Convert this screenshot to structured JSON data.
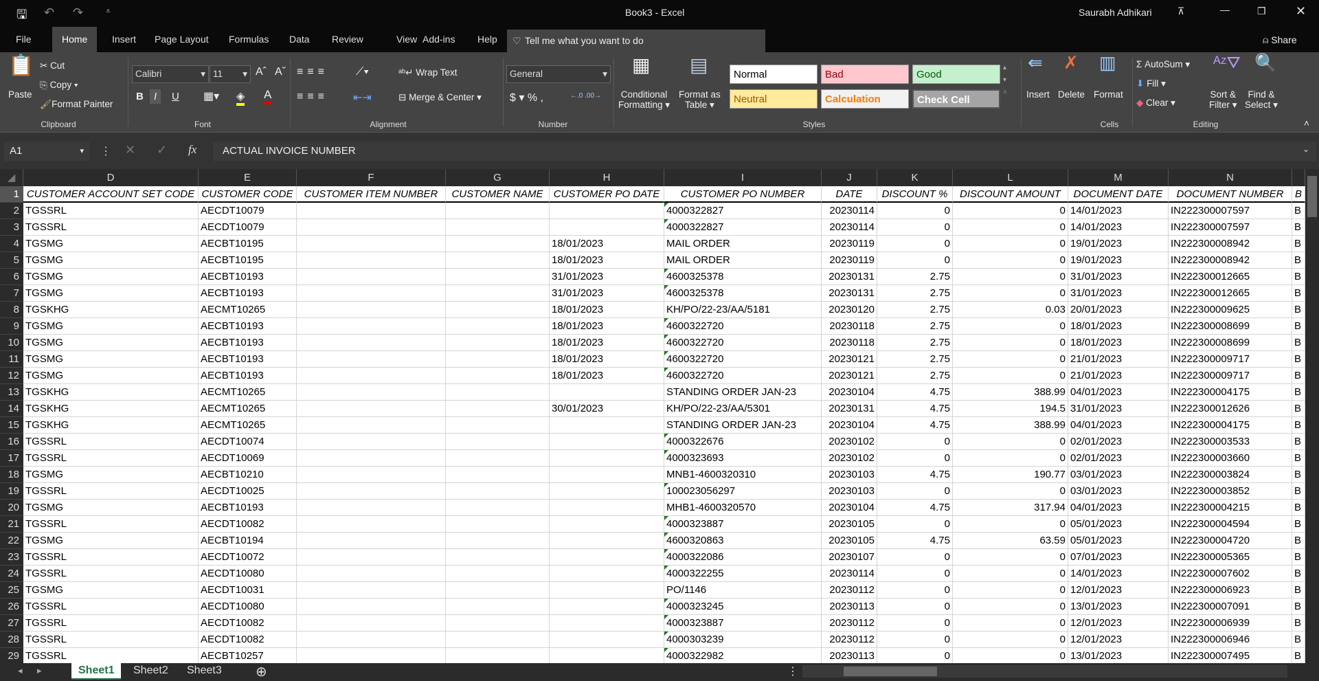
{
  "window": {
    "title": "Book3  -  Excel",
    "user": "Saurabh Adhikari",
    "share": "Share"
  },
  "menu_tabs": [
    "File",
    "Home",
    "Insert",
    "Page Layout",
    "Formulas",
    "Data",
    "Review",
    "View",
    "Add-ins",
    "Help"
  ],
  "active_tab": "Home",
  "tell_me": "Tell me what you want to do",
  "ribbon": {
    "clipboard": {
      "paste": "Paste",
      "cut": "Cut",
      "copy": "Copy",
      "format_painter": "Format Painter",
      "label": "Clipboard"
    },
    "font": {
      "name": "Calibri",
      "size": "11",
      "label": "Font",
      "bold": "B",
      "italic": "I",
      "underline": "U"
    },
    "alignment": {
      "wrap": "Wrap Text",
      "merge": "Merge & Center",
      "label": "Alignment"
    },
    "number": {
      "format": "General",
      "label": "Number"
    },
    "styles": {
      "conditional": "Conditional",
      "conditional2": "Formatting",
      "format_table": "Format as",
      "format_table2": "Table",
      "label": "Styles",
      "cells": [
        {
          "name": "Normal",
          "bg": "#ffffff",
          "fg": "#000000"
        },
        {
          "name": "Bad",
          "bg": "#ffc7ce",
          "fg": "#9c0006"
        },
        {
          "name": "Good",
          "bg": "#c6efce",
          "fg": "#006100"
        },
        {
          "name": "Neutral",
          "bg": "#ffeb9c",
          "fg": "#9c5700"
        },
        {
          "name": "Calculation",
          "bg": "#f2f2f2",
          "fg": "#fa7d00"
        },
        {
          "name": "Check Cell",
          "bg": "#a5a5a5",
          "fg": "#ffffff"
        }
      ]
    },
    "cells": {
      "insert": "Insert",
      "delete": "Delete",
      "format": "Format",
      "label": "Cells"
    },
    "editing": {
      "autosum": "AutoSum",
      "fill": "Fill",
      "clear": "Clear",
      "sort": "Sort &",
      "sort2": "Filter",
      "find": "Find &",
      "find2": "Select",
      "label": "Editing"
    }
  },
  "formula_bar": {
    "name_box": "A1",
    "formula": "ACTUAL INVOICE NUMBER"
  },
  "columns": [
    "D",
    "E",
    "F",
    "G",
    "H",
    "I",
    "J",
    "K",
    "L",
    "M",
    "N",
    ""
  ],
  "headers": [
    "CUSTOMER ACCOUNT SET CODE",
    "CUSTOMER CODE",
    "CUSTOMER ITEM NUMBER",
    "CUSTOMER NAME",
    "CUSTOMER PO DATE",
    "CUSTOMER PO NUMBER",
    "DATE",
    "DISCOUNT %",
    "DISCOUNT AMOUNT",
    "DOCUMENT DATE",
    "DOCUMENT NUMBER",
    "B"
  ],
  "rows": [
    [
      "TGSSRL",
      "AECDT10079",
      "",
      "",
      "",
      "4000322827",
      "20230114",
      "0",
      "0",
      "14/01/2023",
      "IN222300007597",
      "B"
    ],
    [
      "TGSSRL",
      "AECDT10079",
      "",
      "",
      "",
      "4000322827",
      "20230114",
      "0",
      "0",
      "14/01/2023",
      "IN222300007597",
      "B"
    ],
    [
      "TGSMG",
      "AECBT10195",
      "",
      "",
      "18/01/2023",
      "MAIL ORDER",
      "20230119",
      "0",
      "0",
      "19/01/2023",
      "IN222300008942",
      "B"
    ],
    [
      "TGSMG",
      "AECBT10195",
      "",
      "",
      "18/01/2023",
      "MAIL ORDER",
      "20230119",
      "0",
      "0",
      "19/01/2023",
      "IN222300008942",
      "B"
    ],
    [
      "TGSMG",
      "AECBT10193",
      "",
      "",
      "31/01/2023",
      "4600325378",
      "20230131",
      "2.75",
      "0",
      "31/01/2023",
      "IN222300012665",
      "B"
    ],
    [
      "TGSMG",
      "AECBT10193",
      "",
      "",
      "31/01/2023",
      "4600325378",
      "20230131",
      "2.75",
      "0",
      "31/01/2023",
      "IN222300012665",
      "B"
    ],
    [
      "TGSKHG",
      "AECMT10265",
      "",
      "",
      "18/01/2023",
      "KH/PO/22-23/AA/5181",
      "20230120",
      "2.75",
      "0.03",
      "20/01/2023",
      "IN222300009625",
      "B"
    ],
    [
      "TGSMG",
      "AECBT10193",
      "",
      "",
      "18/01/2023",
      "4600322720",
      "20230118",
      "2.75",
      "0",
      "18/01/2023",
      "IN222300008699",
      "B"
    ],
    [
      "TGSMG",
      "AECBT10193",
      "",
      "",
      "18/01/2023",
      "4600322720",
      "20230118",
      "2.75",
      "0",
      "18/01/2023",
      "IN222300008699",
      "B"
    ],
    [
      "TGSMG",
      "AECBT10193",
      "",
      "",
      "18/01/2023",
      "4600322720",
      "20230121",
      "2.75",
      "0",
      "21/01/2023",
      "IN222300009717",
      "B"
    ],
    [
      "TGSMG",
      "AECBT10193",
      "",
      "",
      "18/01/2023",
      "4600322720",
      "20230121",
      "2.75",
      "0",
      "21/01/2023",
      "IN222300009717",
      "B"
    ],
    [
      "TGSKHG",
      "AECMT10265",
      "",
      "",
      "",
      "STANDING ORDER JAN-23",
      "20230104",
      "4.75",
      "388.99",
      "04/01/2023",
      "IN222300004175",
      "B"
    ],
    [
      "TGSKHG",
      "AECMT10265",
      "",
      "",
      "30/01/2023",
      "KH/PO/22-23/AA/5301",
      "20230131",
      "4.75",
      "194.5",
      "31/01/2023",
      "IN222300012626",
      "B"
    ],
    [
      "TGSKHG",
      "AECMT10265",
      "",
      "",
      "",
      "STANDING ORDER JAN-23",
      "20230104",
      "4.75",
      "388.99",
      "04/01/2023",
      "IN222300004175",
      "B"
    ],
    [
      "TGSSRL",
      "AECDT10074",
      "",
      "",
      "",
      "4000322676",
      "20230102",
      "0",
      "0",
      "02/01/2023",
      "IN222300003533",
      "B"
    ],
    [
      "TGSSRL",
      "AECDT10069",
      "",
      "",
      "",
      "4000323693",
      "20230102",
      "0",
      "0",
      "02/01/2023",
      "IN222300003660",
      "B"
    ],
    [
      "TGSMG",
      "AECBT10210",
      "",
      "",
      "",
      "MNB1-4600320310",
      "20230103",
      "4.75",
      "190.77",
      "03/01/2023",
      "IN222300003824",
      "B"
    ],
    [
      "TGSSRL",
      "AECDT10025",
      "",
      "",
      "",
      "100023056297",
      "20230103",
      "0",
      "0",
      "03/01/2023",
      "IN222300003852",
      "B"
    ],
    [
      "TGSMG",
      "AECBT10193",
      "",
      "",
      "",
      "MHB1-4600320570",
      "20230104",
      "4.75",
      "317.94",
      "04/01/2023",
      "IN222300004215",
      "B"
    ],
    [
      "TGSSRL",
      "AECDT10082",
      "",
      "",
      "",
      "4000323887",
      "20230105",
      "0",
      "0",
      "05/01/2023",
      "IN222300004594",
      "B"
    ],
    [
      "TGSMG",
      "AECBT10194",
      "",
      "",
      "",
      "4600320863",
      "20230105",
      "4.75",
      "63.59",
      "05/01/2023",
      "IN222300004720",
      "B"
    ],
    [
      "TGSSRL",
      "AECDT10072",
      "",
      "",
      "",
      "4000322086",
      "20230107",
      "0",
      "0",
      "07/01/2023",
      "IN222300005365",
      "B"
    ],
    [
      "TGSSRL",
      "AECDT10080",
      "",
      "",
      "",
      "4000322255",
      "20230114",
      "0",
      "0",
      "14/01/2023",
      "IN222300007602",
      "B"
    ],
    [
      "TGSMG",
      "AECDT10031",
      "",
      "",
      "",
      "PO/1146",
      "20230112",
      "0",
      "0",
      "12/01/2023",
      "IN222300006923",
      "B"
    ],
    [
      "TGSSRL",
      "AECDT10080",
      "",
      "",
      "",
      "4000323245",
      "20230113",
      "0",
      "0",
      "13/01/2023",
      "IN222300007091",
      "B"
    ],
    [
      "TGSSRL",
      "AECDT10082",
      "",
      "",
      "",
      "4000323887",
      "20230112",
      "0",
      "0",
      "12/01/2023",
      "IN222300006939",
      "B"
    ],
    [
      "TGSSRL",
      "AECDT10082",
      "",
      "",
      "",
      "4000303239",
      "20230112",
      "0",
      "0",
      "12/01/2023",
      "IN222300006946",
      "B"
    ],
    [
      "TGSSRL",
      "AECBT10257",
      "",
      "",
      "",
      "4000322982",
      "20230113",
      "0",
      "0",
      "13/01/2023",
      "IN222300007495",
      "B"
    ]
  ],
  "sheets": [
    "Sheet1",
    "Sheet2",
    "Sheet3"
  ],
  "active_sheet": "Sheet1"
}
